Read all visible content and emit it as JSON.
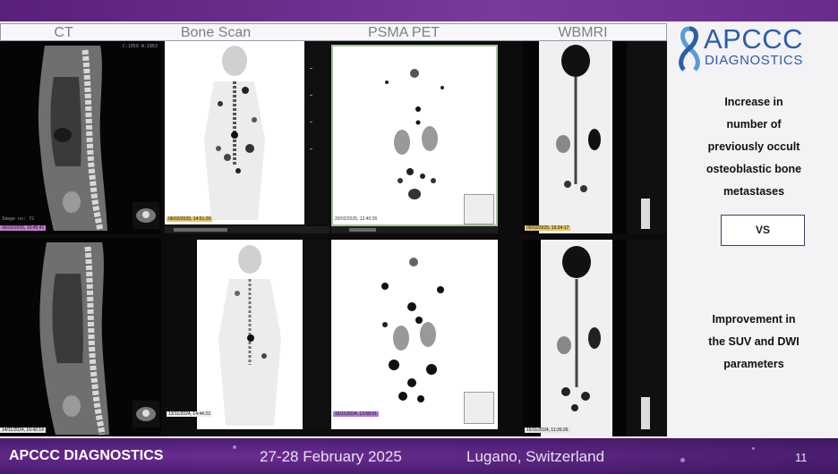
{
  "headers": [
    "CT",
    "Bone Scan",
    "PSMA PET",
    "WBMRI"
  ],
  "logo": {
    "word": "APCCC",
    "sub": "DIAGNOSTICS"
  },
  "side": {
    "finding_lines": [
      "Increase in",
      "number of",
      "previously occult",
      "osteoblastic bone",
      "metastases"
    ],
    "vs": "VS",
    "improvement_lines": [
      "Improvement in",
      "the SUV and DWI",
      "parameters"
    ]
  },
  "panel_dates": {
    "ct_top": "06/02/2025, 15:45:41",
    "bone_top": "06/02/2025, 14:51:29",
    "pet_top": "20/02/2025, 12:40:26",
    "mri_top": "05/02/2025, 15:34:17",
    "ct_bottom": "14/11/2024, 16:42:14",
    "bone_bottom": "13/11/2024, 14:44:23",
    "pet_bottom": "15/11/2024, 12:58:01",
    "mri_bottom": "15/11/2024, 11:26:26"
  },
  "footer": {
    "brand": "APCCC DIAGNOSTICS",
    "dates": "27-28 February 2025",
    "place": "Lugano, Switzerland",
    "page": "11"
  },
  "colors": {
    "accent": "#2a5fa8",
    "footer_bg": "#4f1f74",
    "date_tag": "#e8c66a",
    "date_tag_pet": "#b07ad8"
  }
}
